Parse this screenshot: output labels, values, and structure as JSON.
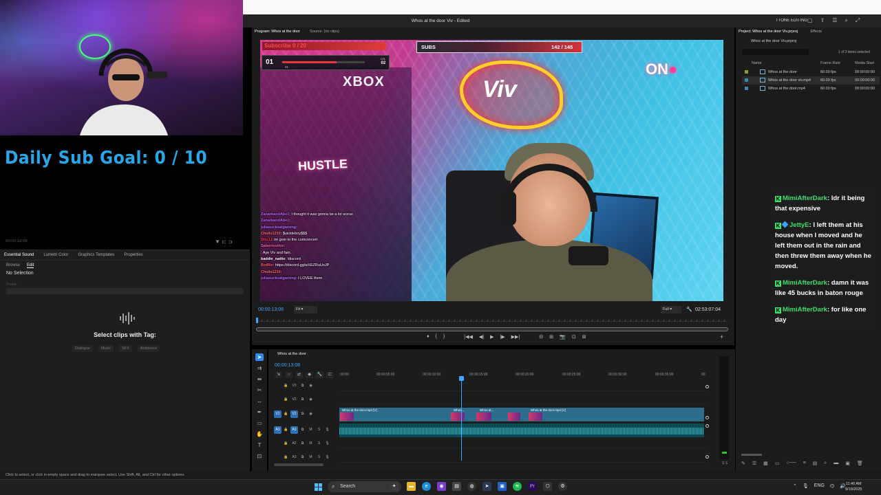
{
  "stream": {
    "goal_text": "Daily Sub Goal:  0 / 10",
    "left_monitor_tc": "00:00:13:08",
    "left_monitor_icons": "▼ ⊏ ⊐"
  },
  "essential_sound": {
    "tabs": [
      "Essential Sound",
      "Lumetri Color",
      "Graphics Templates",
      "Properties"
    ],
    "subtabs": [
      "Browse",
      "Edit"
    ],
    "no_selection": "No Selection",
    "preset_label": "Preset:",
    "select_clips": "Select clips with Tag:",
    "tags": [
      "Dialogue",
      "Music",
      "SFX",
      "Ambience"
    ]
  },
  "status_bar": "Click to select, or click in empty space and drag to marquee select. Use Shift, Alt, and Ctrl for other options.",
  "app": {
    "document_title": "Whos at the door Viv - Edited",
    "workspace": "TTONE EDITING"
  },
  "program": {
    "tabs": [
      "Program: Whos at the door",
      "Source: (no clips)"
    ],
    "timecode": "00:00:13:08",
    "fit": "Fit",
    "quality": "Full",
    "duration": "02:53:07:04",
    "transport": [
      "♦",
      "{",
      "}",
      "|◀◀",
      "◀|",
      "▶",
      "|▶",
      "▶▶|",
      "⊟",
      "⊞",
      "📷",
      "⊡",
      "⊞"
    ],
    "add": "+"
  },
  "overlay": {
    "game_top": "Subscribe 0 / 20",
    "game_num": "01",
    "game_small": "21",
    "game_lvl_label": "LVL",
    "game_lvl": "02",
    "game_progress": 0.66,
    "subs_label": "SUBS",
    "subs_value": "142 / 145",
    "xbox": "XBOX",
    "hustle": "HUSTLE",
    "neon": "Viv",
    "onair": "ON"
  },
  "stream_chat": [
    {
      "user": "ZanarkandAbe1",
      "msg": ": I thought it was gonna be a lot worse",
      "color": "#b26cff"
    },
    {
      "user": "ZanarkandAbe1",
      "msg": ":",
      "color": "#b26cff"
    },
    {
      "user": "juliasucksatgaming",
      "msg": ":",
      "color": "#b26cff"
    },
    {
      "user": "Chelle1210",
      "msg": ": $uicideboy$$$",
      "color": "#ff6a6a"
    },
    {
      "user": "StixJJ",
      "msg": ": im goin to the cumconcert",
      "color": "#ff3a3a"
    },
    {
      "user": "Sabertoothie",
      "msg": ":",
      "color": "#ff5fa8"
    },
    {
      "user": "",
      "msg": ": Aye Viv and fam.",
      "color": "#ff5fa8"
    },
    {
      "user": "baddie_nattie",
      "msg": ": !discord",
      "color": "#fff"
    },
    {
      "user": "BotRix",
      "msg": ": https://discord.gg/wXEZRuUnJP",
      "color": "#ff5f5f"
    },
    {
      "user": "Chelle1210",
      "msg": ":",
      "color": "#ff6a6a"
    },
    {
      "user": "juliasucksatgaming",
      "msg": ": I LOVEE them",
      "color": "#b26cff"
    }
  ],
  "project": {
    "tabs": [
      "Project: Whos at the door Viv.prproj",
      "Effects"
    ],
    "file": "Whos at the door Viv.prproj",
    "count": "1 of 3 items selected",
    "col_name": "Name",
    "col_fps": "Frame Rate",
    "col_start": "Media Start",
    "items": [
      {
        "name": "Whos at the door",
        "fps": "60.00 fps",
        "start": "00:00:00:00",
        "swatch": "#8a9a2a"
      },
      {
        "name": "Whos at the door viv.mp4",
        "fps": "60.00 fps",
        "start": "00:00:00:00",
        "swatch": "#3a8ab0"
      },
      {
        "name": "Whos at the door.mp4",
        "fps": "60.00 fps",
        "start": "00:00:00:00",
        "swatch": "#3a8ab0"
      }
    ]
  },
  "right_chat": [
    {
      "user": "MimiAfterDark",
      "msg": ": ldr it being that expensive",
      "diamond": false
    },
    {
      "user": "JettyE",
      "msg": ": I left them at his house when I moved and he left them out in the rain and then threw them away when he moved.",
      "diamond": true
    },
    {
      "user": "MimiAfterDark",
      "msg": ": damn it was like 45 bucks in baton rouge",
      "diamond": false
    },
    {
      "user": "MimiAfterDark",
      "msg": ": for like one day",
      "diamond": false
    }
  ],
  "timeline": {
    "title": "Whos at the door",
    "timecode": "00:00:13:08",
    "ruler": [
      ":00:00",
      "00:00:05:00",
      "00:00:10:00",
      "00:00:15:00",
      "00:00:20:00",
      "00:00:25:00",
      "00:00:30:00",
      "00:00:35:00",
      "00"
    ],
    "tracks": [
      {
        "label": "V3",
        "video": true
      },
      {
        "label": "V2",
        "video": true
      },
      {
        "label": "V1",
        "video": true,
        "active": true
      },
      {
        "label": "A1",
        "video": false,
        "active": true
      },
      {
        "label": "A2",
        "video": false
      },
      {
        "label": "A3",
        "video": false
      }
    ],
    "clip_labels": [
      "Whos at the door.mp4 [V]",
      "Whos...",
      "Whos at...",
      "Whos at the door.mp4 [V]"
    ],
    "meter_label": "S S"
  },
  "taskbar": {
    "search": "Search",
    "lang": "ENG",
    "time": "11:40 AM",
    "date": "9/19/2025"
  }
}
